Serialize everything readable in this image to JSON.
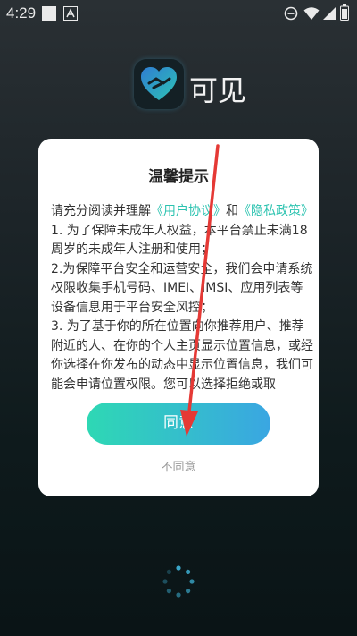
{
  "status_bar": {
    "time": "4:29",
    "icons": [
      "square-notification-icon",
      "a-notification-icon",
      "do-not-disturb-icon",
      "wifi-icon",
      "signal-icon",
      "battery-icon"
    ]
  },
  "app": {
    "name": "可见",
    "logo_icon": "heart-handshake-icon"
  },
  "dialog": {
    "title": "温馨提示",
    "intro_prefix": "请充分阅读并理解",
    "user_agreement_link": "《用户协议》",
    "and": "和",
    "privacy_policy_link": "《隐私政策》",
    "clause_1": "1. 为了保障未成年人权益，本平台禁止未满18周岁的未成年人注册和使用；",
    "clause_2": "2.为保障平台安全和运营安全，我们会申请系统权限收集手机号码、IMEI、IMSI、应用列表等设备信息用于平台安全风控；",
    "clause_3": "3. 为了基于你的所在位置向你推荐用户、推荐附近的人、在你的个人主页显示位置信息，或经你选择在你发布的动态中显示位置信息，我们可能会申请位置权限。您可以选择拒绝或取",
    "agree_label": "同意",
    "disagree_label": "不同意"
  },
  "colors": {
    "accent_link": "#2cc3b0",
    "button_gradient_start": "#2ed8b4",
    "button_gradient_end": "#3aa6e2",
    "annotation_arrow": "#e53935"
  }
}
